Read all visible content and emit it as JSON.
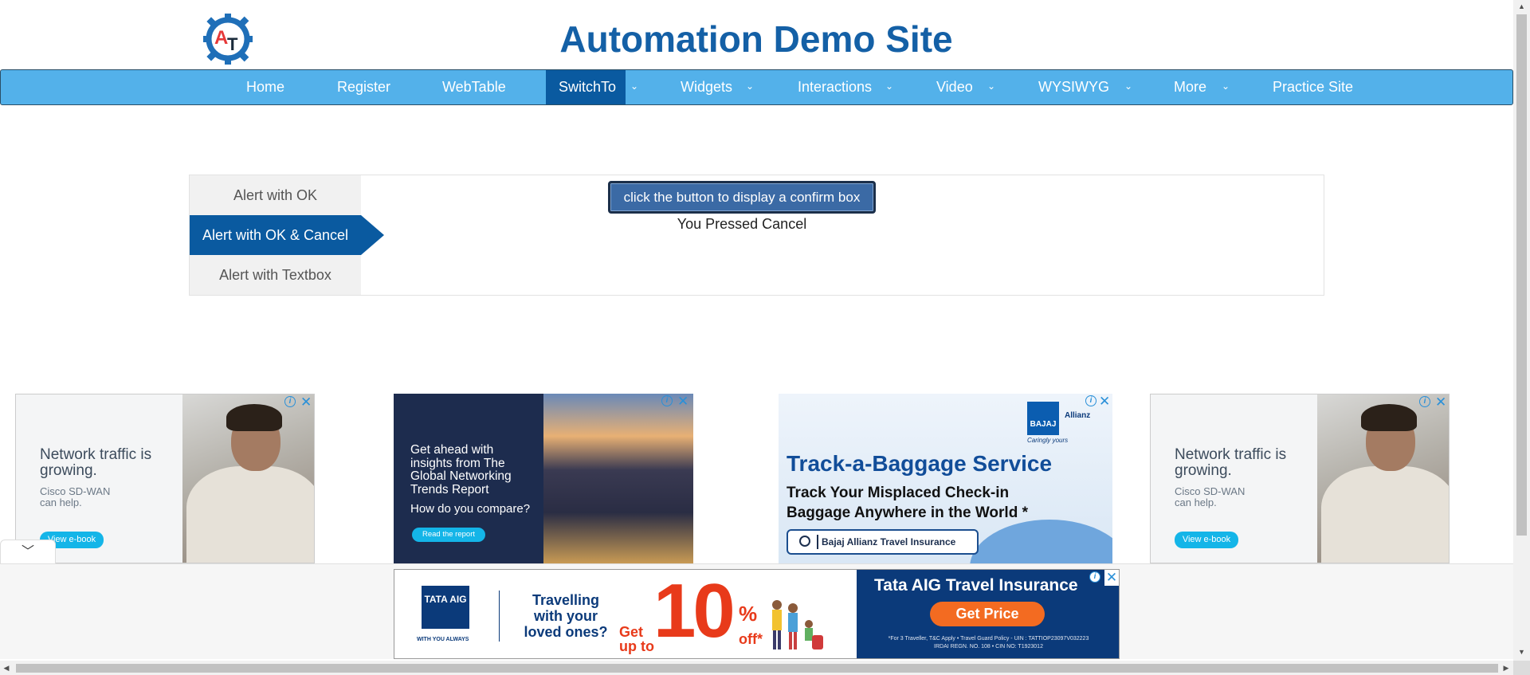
{
  "header": {
    "logo_text": "AT",
    "site_title": "Automation Demo Site"
  },
  "navbar": {
    "items": [
      {
        "label": "Home"
      },
      {
        "label": "Register"
      },
      {
        "label": "WebTable"
      },
      {
        "label": "SwitchTo",
        "active": true
      },
      {
        "label": "Widgets"
      },
      {
        "label": "Interactions"
      },
      {
        "label": "Video"
      },
      {
        "label": "WYSIWYG"
      },
      {
        "label": "More"
      },
      {
        "label": "Practice Site"
      }
    ],
    "caret_icon": "chevron-down-icon"
  },
  "alerts": {
    "tabs": [
      {
        "label": "Alert with OK"
      },
      {
        "label": "Alert with OK & Cancel",
        "active": true
      },
      {
        "label": "Alert with Textbox"
      }
    ],
    "button_label": "click the button to display a confirm box",
    "result_text": "You Pressed Cancel"
  },
  "ads": {
    "cisco": {
      "headline": "Network traffic is growing.",
      "sub": "Cisco SD-WAN can help.",
      "cta": "View e-book"
    },
    "network_trends": {
      "headline": "Get ahead with insights from The Global Networking Trends Report",
      "question": "How do you compare?",
      "cta": "Read the report"
    },
    "bajaj": {
      "brand": "BAJAJ",
      "partner": "Allianz",
      "tagline": "Caringly yours",
      "headline": "Track-a-Baggage Service",
      "line1": "Track Your Misplaced Check-in",
      "line2": "Baggage Anywhere in the World *",
      "search_text": "Bajaj Allianz Travel Insurance"
    },
    "tata": {
      "logo": "TATA AIG",
      "logo_sub": "WITH YOU ALWAYS",
      "travel_text": "Travelling with your loved ones?",
      "get_up_to": "Get up to",
      "ten": "10",
      "percent": "%",
      "off": "off*",
      "title": "Tata AIG Travel Insurance",
      "cta": "Get Price",
      "fine_1": "*For 3 Traveller, T&C Apply • Travel Guard Policy - UIN : TATTIOP23097V032223",
      "fine_2": "IRDAI REGN. NO. 108 • CIN NO: T1923012"
    },
    "info_icon": "i",
    "close_icon": "✕"
  },
  "colors": {
    "brand_blue": "#1460a6",
    "navbar": "#53b1ea",
    "active": "#0a5aa0"
  }
}
